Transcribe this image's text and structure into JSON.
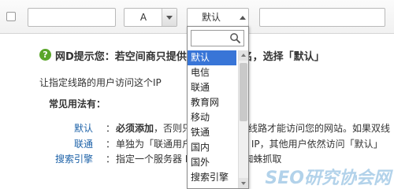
{
  "toolbar": {
    "record_type": "A",
    "line": "默认"
  },
  "hint": {
    "title": "网D提示您：若空间商只提供IP 地址或域名，选择「默认」",
    "text": "让指定线路的用户访问这个IP"
  },
  "usage": {
    "title": "常见用法有：",
    "rows": [
      {
        "term": "默认",
        "bold": "必须添加",
        "desc": "，否则只有单独指定的线路才能访问您的网站。如果双线"
      },
      {
        "term": "联通",
        "bold": "",
        "desc": "单独为「联通用户」指定服务器 IP，其他用户依然访问「默认」"
      },
      {
        "term": "搜索引擎",
        "bold": "",
        "desc": "指定一个服务器 IP 给搜索引擎蜘蛛抓取"
      }
    ]
  },
  "dropdown": {
    "items": [
      "默认",
      "电信",
      "联通",
      "教育网",
      "移动",
      "铁通",
      "国内",
      "国外",
      "搜索引擎"
    ],
    "selected_index": 0
  },
  "watermark": {
    "text": "SEO研究协会网",
    "url": "www.seoxiehui.cn"
  },
  "colors": {
    "accent": "#3875d7",
    "link": "#1d62a8",
    "hint_icon": "#5aa62a"
  }
}
